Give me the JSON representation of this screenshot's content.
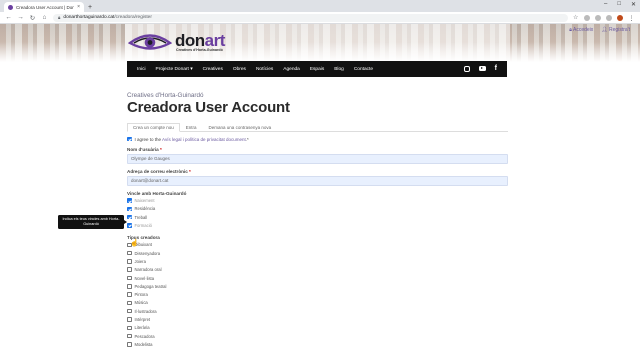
{
  "browser": {
    "tab_title": "Creadora User Account | Donart",
    "new_tab": "+",
    "url_host": "donarthortaguinardo.cat",
    "url_path": "/creadora/register",
    "min": "–",
    "max": "□",
    "close": "✕"
  },
  "account": {
    "login": "Accedeix",
    "register": "Registra't"
  },
  "logo": {
    "brand_don": "don",
    "brand_art": "art",
    "tagline": "Creatives d'Horta-Guinardó"
  },
  "nav": {
    "items": [
      "Inici",
      "Projecte Donart ▾",
      "Creatives",
      "Obres",
      "Notícies",
      "Agenda",
      "Espais",
      "Blog",
      "Contacte"
    ]
  },
  "page": {
    "subtitle": "Creatives d'Horta-Guinardó",
    "title": "Creadora User Account",
    "tabs": [
      "Crea un compte nou",
      "Entra",
      "Demana una contrasenya nova"
    ]
  },
  "form": {
    "agree_prefix": "I agree to the ",
    "agree_link": "Avís legal i política de privacitat document",
    "agree_suffix": ".*",
    "username_label": "Nom d'usuària",
    "username_value": "Olympe de Gauges",
    "email_label": "Adreça de correu electrònic",
    "email_value": "donart@donart.cat",
    "req": "*",
    "vincle_label": "Vincle amb Horta-Guinardó",
    "vincle_options": [
      {
        "label": "Naixement",
        "checked": true
      },
      {
        "label": "Residència",
        "checked": true
      },
      {
        "label": "Treball",
        "checked": true
      },
      {
        "label": "Formació",
        "checked": true
      }
    ],
    "tipus_label": "Tipus creadora",
    "tipus_options": [
      "Dibuixant",
      "Dissenyadora",
      "Joiera",
      "Narradora oral",
      "Novel·lista",
      "Pedagoga teatral",
      "Pintora",
      "Música",
      "Il·lustradora",
      "Intèrpret",
      "Literària",
      "Pescadora",
      "Modelista"
    ]
  },
  "tooltip": {
    "text": "Indica els teus vincles amb Horta-Guinardó"
  }
}
